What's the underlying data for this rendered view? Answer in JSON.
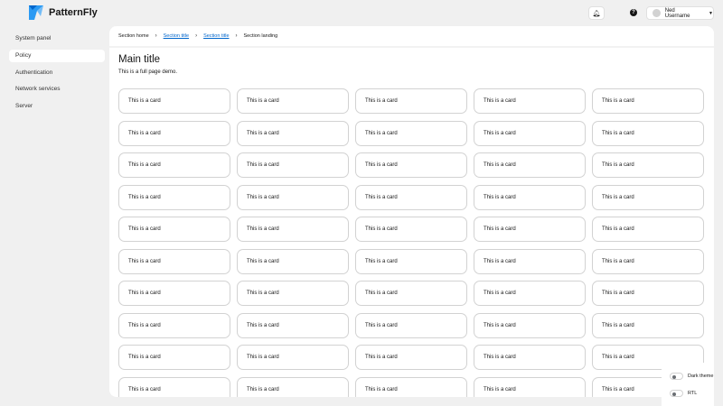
{
  "brand": {
    "name": "PatternFly",
    "accent": "#2b9af3"
  },
  "header": {
    "notification_icon": "bell-icon",
    "help_icon": "help-icon",
    "user": "Ned Username"
  },
  "sidebar": {
    "items": [
      {
        "label": "System panel"
      },
      {
        "label": "Policy",
        "active": true
      },
      {
        "label": "Authentication"
      },
      {
        "label": "Network services"
      },
      {
        "label": "Server"
      }
    ]
  },
  "breadcrumb": [
    "Section home",
    "Section title",
    "Section title",
    "Section landing"
  ],
  "main": {
    "title": "Main title",
    "subtitle": "This is a full page demo."
  },
  "card_label": "This is a card",
  "card_count": 50,
  "theme_panel": {
    "dark_theme": "Dark theme",
    "rtl": "RTL"
  }
}
